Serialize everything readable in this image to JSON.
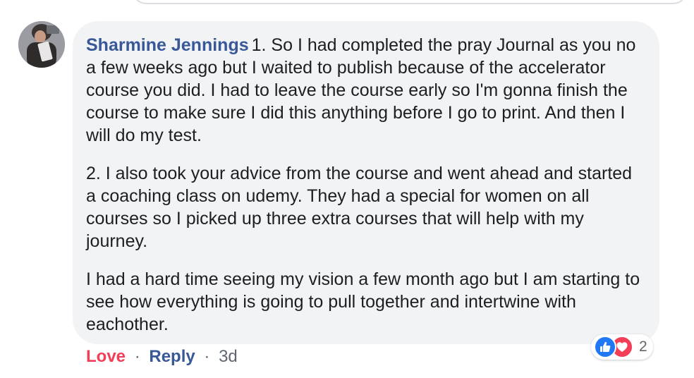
{
  "comment": {
    "author": "Sharmine Jennings",
    "paragraphs": [
      "1. So I had completed the pray Journal as you no a few weeks ago but I waited to publish because of the accelerator course you did. I had to leave the course early so I'm gonna finish the course to make sure I did this anything before I go to print. And then I will do my test.",
      "2. I also took your advice from the course and went ahead and started a coaching class on udemy. They had a special for women on all courses so I picked up three extra courses that will help with my journey.",
      "I had a hard time seeing my vision a few month ago but I am starting to see how everything is going to pull together and intertwine with eachother."
    ]
  },
  "actions": {
    "love_label": "Love",
    "separator": "·",
    "reply_label": "Reply",
    "timestamp": "3d"
  },
  "reactions": {
    "count": "2",
    "icons": [
      "like-icon",
      "love-icon"
    ]
  },
  "colors": {
    "author_link": "#385898",
    "love_active": "#f33e58",
    "like_blue": "#2078f4",
    "bubble_bg": "#f2f3f5"
  }
}
